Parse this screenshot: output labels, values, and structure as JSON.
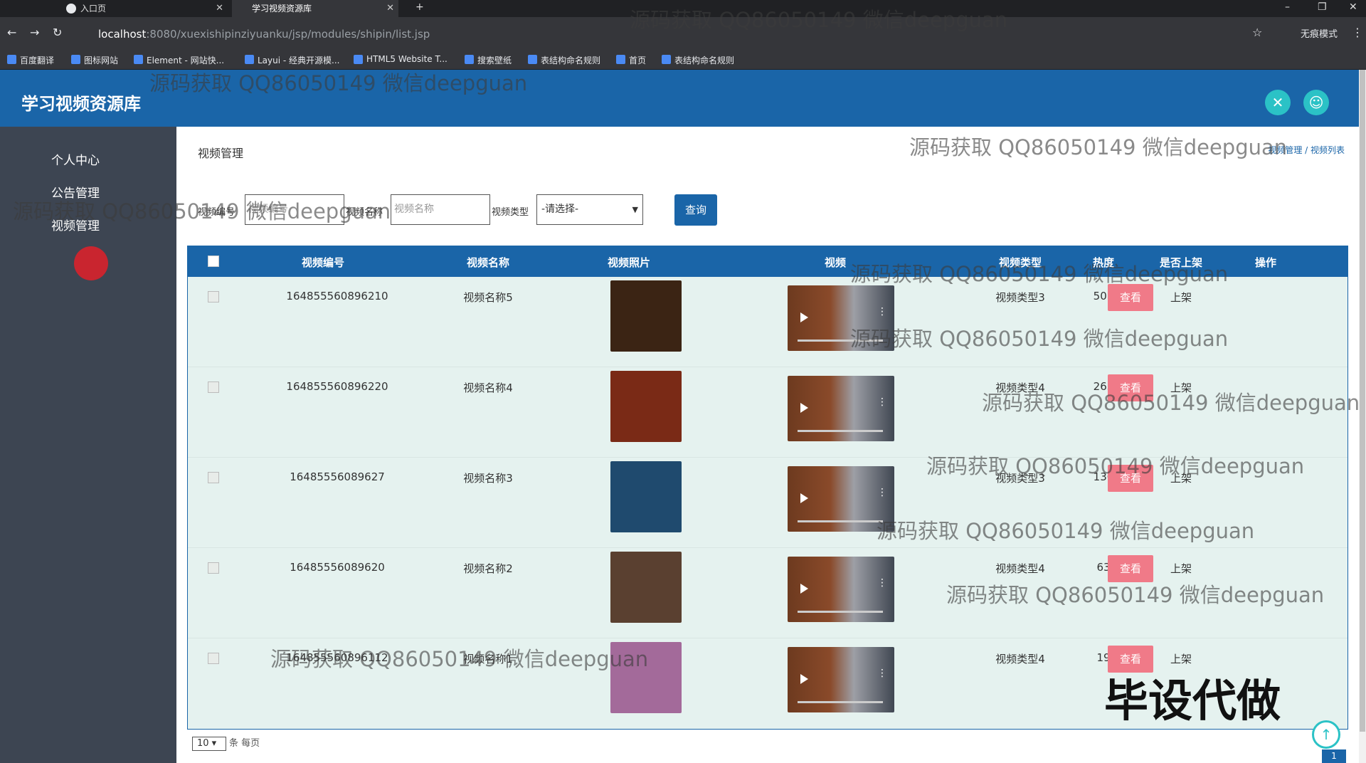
{
  "browser": {
    "tabs": [
      {
        "label": "入口页"
      },
      {
        "label": "学习视频资源库"
      }
    ],
    "url_host": "localhost",
    "url_path": ":8080/xuexishipinziyuanku/jsp/modules/shipin/list.jsp",
    "incognito_label": "无痕模式",
    "bookmarks": [
      "百度翻译",
      "图标网站",
      "Element - 网站快...",
      "Layui - 经典开源模...",
      "HTML5 Website T...",
      "搜索壁纸",
      "表结构命名规则",
      "首页",
      "表结构命名规则"
    ]
  },
  "app": {
    "title": "学习视频资源库",
    "sidebar": [
      "个人中心",
      "公告管理",
      "视频管理"
    ],
    "page_title": "视频管理",
    "breadcrumb": "视频管理 / 视频列表"
  },
  "search": {
    "label_code": "视频编号",
    "placeholder_code": "视频编号",
    "label_name": "视频名称",
    "placeholder_name": "视频名称",
    "label_type": "视频类型",
    "type_selected": "-请选择-",
    "button": "查询"
  },
  "table": {
    "headers": [
      "视频编号",
      "视频名称",
      "视频照片",
      "视频",
      "视频类型",
      "热度",
      "是否上架",
      "操作"
    ],
    "rows": [
      {
        "code": "164855560896210",
        "name": "视频名称5",
        "type": "视频类型3",
        "heat": "507",
        "status": "上架",
        "action": "查看",
        "photo_color": "#3b2414"
      },
      {
        "code": "164855560896220",
        "name": "视频名称4",
        "type": "视频类型4",
        "heat": "263",
        "status": "上架",
        "action": "查看",
        "photo_color": "#7a2a16"
      },
      {
        "code": "16485556089627",
        "name": "视频名称3",
        "type": "视频类型3",
        "heat": "130",
        "status": "上架",
        "action": "查看",
        "photo_color": "#1f4a6e"
      },
      {
        "code": "16485556089620",
        "name": "视频名称2",
        "type": "视频类型4",
        "heat": "63",
        "status": "上架",
        "action": "查看",
        "photo_color": "#5a4030"
      },
      {
        "code": "164855560896112",
        "name": "视频名称1",
        "type": "视频类型4",
        "heat": "19",
        "status": "上架",
        "action": "查看",
        "photo_color": "#a36a9a"
      }
    ]
  },
  "pager": {
    "page_size": "10",
    "page_size_suffix": "条 每页",
    "current_page": "1"
  },
  "watermark": {
    "text": "源码获取 QQ86050149 微信deepguan",
    "big_text": "毕设代做"
  },
  "colors": {
    "primary": "#1a65a8",
    "sidebar": "#3d4552",
    "view_button": "#f07a88",
    "accent": "#2bc2c6"
  }
}
